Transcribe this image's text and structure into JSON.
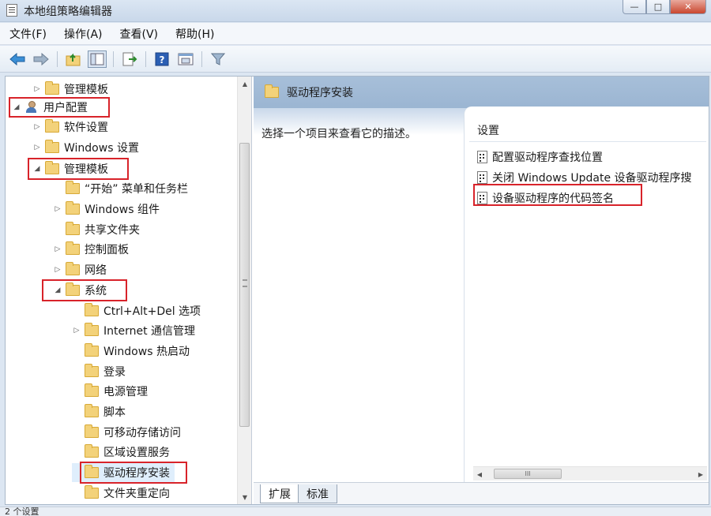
{
  "window": {
    "title": "本地组策略编辑器",
    "buttons": {
      "minimize": "—",
      "maximize": "□",
      "close": "✕"
    }
  },
  "menu": [
    "文件(F)",
    "操作(A)",
    "查看(V)",
    "帮助(H)"
  ],
  "toolbar": {
    "icons": [
      "back-arrow-icon",
      "forward-arrow-icon",
      "up-folder-icon",
      "show-hide-tree-icon",
      "export-list-icon",
      "help-icon",
      "properties-icon",
      "filter-icon"
    ]
  },
  "tree": {
    "items": [
      {
        "label": "管理模板",
        "level": 1,
        "expander": "▷"
      },
      {
        "label": "用户配置",
        "level": 0,
        "expander": "◢",
        "icon": "user"
      },
      {
        "label": "软件设置",
        "level": 1,
        "expander": "▷"
      },
      {
        "label": "Windows 设置",
        "level": 1,
        "expander": "▷"
      },
      {
        "label": "管理模板",
        "level": 1,
        "expander": "◢"
      },
      {
        "label": "“开始” 菜单和任务栏",
        "level": 2,
        "expander": ""
      },
      {
        "label": "Windows 组件",
        "level": 2,
        "expander": "▷"
      },
      {
        "label": "共享文件夹",
        "level": 2,
        "expander": ""
      },
      {
        "label": "控制面板",
        "level": 2,
        "expander": "▷"
      },
      {
        "label": "网络",
        "level": 2,
        "expander": "▷"
      },
      {
        "label": "系统",
        "level": 2,
        "expander": "◢"
      },
      {
        "label": "Ctrl+Alt+Del 选项",
        "level": 3,
        "expander": ""
      },
      {
        "label": "Internet 通信管理",
        "level": 3,
        "expander": "▷"
      },
      {
        "label": "Windows 热启动",
        "level": 3,
        "expander": ""
      },
      {
        "label": "登录",
        "level": 3,
        "expander": ""
      },
      {
        "label": "电源管理",
        "level": 3,
        "expander": ""
      },
      {
        "label": "脚本",
        "level": 3,
        "expander": ""
      },
      {
        "label": "可移动存储访问",
        "level": 3,
        "expander": ""
      },
      {
        "label": "区域设置服务",
        "level": 3,
        "expander": ""
      },
      {
        "label": "驱动程序安装",
        "level": 3,
        "expander": ""
      },
      {
        "label": "文件夹重定向",
        "level": 3,
        "expander": ""
      }
    ]
  },
  "right": {
    "header_title": "驱动程序安装",
    "description": "选择一个项目来查看它的描述。",
    "settings_header": "设置",
    "settings": [
      "配置驱动程序查找位置",
      "关闭 Windows Update 设备驱动程序搜",
      "设备驱动程序的代码签名"
    ],
    "hscroll_grip": "III",
    "tabs": [
      "扩展",
      "标准"
    ]
  },
  "status": "2 个设置",
  "colors": {
    "highlight_box": "#d8232a",
    "folder": "#f3d27a",
    "header": "#a7bfd9"
  }
}
